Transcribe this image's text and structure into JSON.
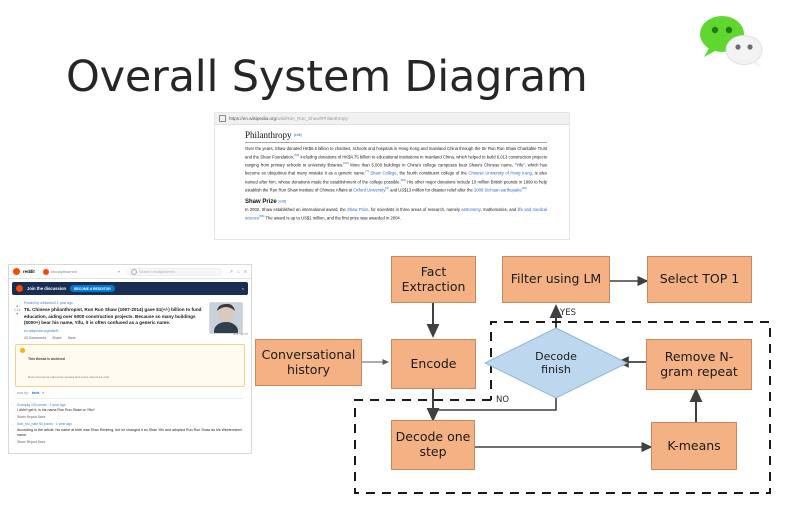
{
  "slide": {
    "title": "Overall System Diagram",
    "background": "#ffffff",
    "logo": "wechat-logo"
  },
  "wikipedia": {
    "url_secure": "https://",
    "url_domain": "en.wikipedia.org",
    "url_path": "/wiki/Run_Run_Shaw#Philanthropy",
    "lock_icon": "lock-icon",
    "section1_title": "Philanthropy",
    "section1_edit": "[edit]",
    "section1_paragraph": "Over the years, Shaw donated HK$6.5 billion to charities, schools and hospitals in Hong Kong and mainland China through the Sir Run Run Shaw Charitable Trust and the Shaw Foundation,",
    "section1_ref1": "[63]",
    "section1_paragraph_b": " including donations of HK$4.75 billion to educational institutions in mainland China, which helped to build 6,013 construction projects ranging from primary schools to university libraries.",
    "section1_ref2": "[64]",
    "section1_paragraph_c": " More than 5,000 buildings in China's college campuses bear Shaw's Chinese name, \"Yifu\", which has become so ubiquitous that many mistake it as a generic name.",
    "section1_ref3": "[7]",
    "link_shaw_college": "Shaw College",
    "section1_paragraph_d": ", the fourth constituent college of the ",
    "link_cuhk": "Chinese University of Hong Kong",
    "section1_paragraph_e": ", is also named after him, whose donations made the establishment of the college possible.",
    "section1_ref4": "[65]",
    "section1_paragraph_f": " His other major donations include 10 million British pounds in 1990 to help establish the Run Run Shaw Institute of Chinese Affairs at ",
    "link_oxford": "Oxford University",
    "section1_ref5": "[9]",
    "section1_paragraph_g": " and US$13 million for disaster relief after the ",
    "link_sichuan": "2008 Sichuan earthquake",
    "section1_ref6": "[15]",
    "section2_title": "Shaw Prize",
    "section2_edit": "[edit]",
    "section2_paragraph": "In 2002, Shaw established an international award, the ",
    "link_shaw_prize": "Shaw Prize",
    "section2_paragraph_b": ", for scientists in three areas of research, namely ",
    "link_astronomy": "astronomy",
    "section2_paragraph_c": ", mathematics, and ",
    "link_life_med": "life and medical science",
    "section2_ref": "[66]",
    "section2_paragraph_d": " The award is up to US$1 million, and the first prize was awarded in 2004."
  },
  "reddit": {
    "brand": "reddit",
    "logo_icon": "reddit-logo-icon",
    "subreddit": "r/todayilearned",
    "subreddit_icon": "subreddit-icon",
    "caret_icon": "chevron-down-icon",
    "search_placeholder": "Search r/todayilearned",
    "search_icon": "search-icon",
    "icon_trending": "trending-icon",
    "icon_user": "user-icon",
    "icon_menu": "menu-icon",
    "banner_text": "Join the discussion",
    "banner_button": "BECOME A REDDITOR",
    "banner_close": "close-icon",
    "post_meta": "Posted by u/blumbo3 1 year ago",
    "post_award": "award-icon",
    "post_title": "TIL Chinese philanthropist, Run Run Shaw (1907-2014) gave $1(+/-) billion to fund education, aiding over 6000 construction projects. Because so many buildings (5000+) bear his name, Yifu, it is often confused as a generic name.",
    "post_domain": "en.wikipedia.org/wiki/R...",
    "post_score": "1.1k",
    "upvote_icon": "upvote-arrow-icon",
    "downvote_icon": "downvote-arrow-icon",
    "action_comments": "23 Comments",
    "action_share": "Share",
    "action_save": "Save",
    "thumbnail": "post-thumbnail-image",
    "right_meta": "hide  report",
    "archived_title": "This thread is archived",
    "archived_sub": "New comments cannot be posted and votes cannot be cast",
    "archived_icon": "warning-icon",
    "sort_label": "sort by:",
    "sort_value": "best",
    "sort_caret": "chevron-down-icon",
    "comments": [
      {
        "meta": "Grumpig 103 points · 1 year ago",
        "body": "I didn't get it, is his name Run Run Shaw or Yifu?",
        "actions": "Share  Report  Save",
        "collapse": "collapse-icon"
      },
      {
        "meta": "Sub_Mu_nate 54 points · 1 year ago",
        "body": "According to the article, his name at birth was Shao Renleng, but he changed it so Shao Yifu and adopted Run Run Shaw as his Westernized name.",
        "actions": "Share  Report  Save",
        "collapse": "collapse-icon"
      }
    ]
  },
  "flowchart": {
    "colors": {
      "process_fill": "#F4B183",
      "process_stroke": "#c9895c",
      "decision_fill": "#BDD7EE",
      "decision_stroke": "#8fb6d6",
      "arrow": "#404040",
      "dashed_loop": "#1a1a1a"
    },
    "nodes": {
      "fact_extraction": "Fact\nExtraction",
      "filter_using_lm": "Filter using LM",
      "select_top1": "Select TOP 1",
      "conversational_history": "Conversational\nhistory",
      "encode": "Encode",
      "decode_finish": "Decode\nfinish",
      "remove_ngram": "Remove N-\ngram repeat",
      "decode_one_step": "Decode one\nstep",
      "kmeans": "K-means"
    },
    "edge_labels": {
      "yes": "YES",
      "no": "NO"
    }
  }
}
